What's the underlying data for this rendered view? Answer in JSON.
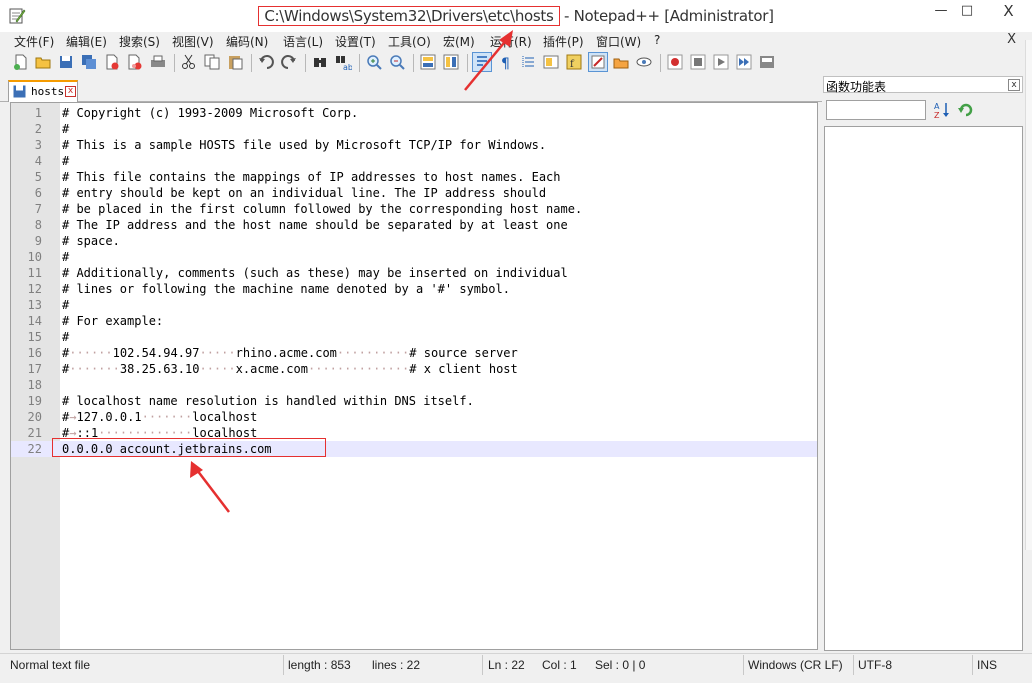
{
  "window": {
    "title_path": "C:\\Windows\\System32\\Drivers\\etc\\hosts",
    "title_suffix": " - Notepad++ [Administrator]",
    "minimize_glyph": "—",
    "maximize_glyph": "□",
    "close_glyph": "X"
  },
  "menu": {
    "items": [
      "文件(F)",
      "编辑(E)",
      "搜索(S)",
      "视图(V)",
      "编码(N)",
      "语言(L)",
      "设置(T)",
      "工具(O)",
      "宏(M)",
      "运行(R)",
      "插件(P)",
      "窗口(W)",
      "?"
    ],
    "close_glyph": "X"
  },
  "toolbar": {
    "icons": [
      "new-file-icon",
      "open-file-icon",
      "save-icon",
      "save-all-icon",
      "close-icon",
      "close-all-icon",
      "print-icon",
      "cut-icon",
      "copy-icon",
      "paste-icon",
      "undo-icon",
      "redo-icon",
      "find-icon",
      "replace-icon",
      "zoom-in-icon",
      "zoom-out-icon",
      "sync-vertical-icon",
      "sync-horizontal-icon",
      "word-wrap-icon",
      "show-all-chars-icon",
      "indent-guide-icon",
      "doc-map-icon",
      "function-list-icon",
      "folder-as-workspace-icon",
      "monitoring-icon",
      "record-macro-icon",
      "stop-macro-icon",
      "play-macro-icon",
      "play-multiple-icon",
      "save-macro-icon"
    ]
  },
  "tab": {
    "label": "hosts",
    "close_glyph": "x"
  },
  "editor": {
    "lines": [
      {
        "num": "1",
        "text": "# Copyright (c) 1993-2009 Microsoft Corp."
      },
      {
        "num": "2",
        "text": "#"
      },
      {
        "num": "3",
        "text": "# This is a sample HOSTS file used by Microsoft TCP/IP for Windows."
      },
      {
        "num": "4",
        "text": "#"
      },
      {
        "num": "5",
        "text": "# This file contains the mappings of IP addresses to host names. Each"
      },
      {
        "num": "6",
        "text": "# entry should be kept on an individual line. The IP address should"
      },
      {
        "num": "7",
        "text": "# be placed in the first column followed by the corresponding host name."
      },
      {
        "num": "8",
        "text": "# The IP address and the host name should be separated by at least one"
      },
      {
        "num": "9",
        "text": "# space."
      },
      {
        "num": "10",
        "text": "#"
      },
      {
        "num": "11",
        "text": "# Additionally, comments (such as these) may be inserted on individual"
      },
      {
        "num": "12",
        "text": "# lines or following the machine name denoted by a '#' symbol."
      },
      {
        "num": "13",
        "text": "#"
      },
      {
        "num": "14",
        "text": "# For example:"
      },
      {
        "num": "15",
        "text": "#"
      },
      {
        "num": "16",
        "text": "#······102.54.94.97·····rhino.acme.com··········# source server"
      },
      {
        "num": "17",
        "text": "#·······38.25.63.10·····x.acme.com··············# x client host"
      },
      {
        "num": "18",
        "text": ""
      },
      {
        "num": "19",
        "text": "# localhost name resolution is handled within DNS itself."
      },
      {
        "num": "20",
        "text": "#→127.0.0.1·······localhost"
      },
      {
        "num": "21",
        "text": "#→::1·············localhost"
      },
      {
        "num": "22",
        "text": "0.0.0.0 account.jetbrains.com"
      }
    ]
  },
  "panel": {
    "title": "函数功能表",
    "close_glyph": "x",
    "search_value": ""
  },
  "status": {
    "file_type": "Normal text file",
    "length": "length : 853",
    "lines": "lines : 22",
    "ln": "Ln : 22",
    "col": "Col : 1",
    "sel": "Sel : 0 | 0",
    "eol": "Windows (CR LF)",
    "encoding": "UTF-8",
    "mode": "INS"
  },
  "colors": {
    "annotation": "#e53030",
    "current_line": "#e8e8ff",
    "gutter": "#e4e4e4",
    "tab_accent": "#f59b00"
  }
}
